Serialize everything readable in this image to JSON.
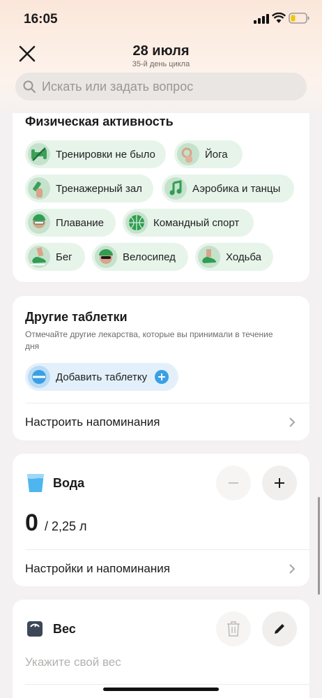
{
  "status_bar": {
    "time": "16:05"
  },
  "header": {
    "title": "28 июля",
    "subtitle": "35-й день цикла"
  },
  "search": {
    "placeholder": "Искать или задать вопрос"
  },
  "activity": {
    "title": "Физическая активность",
    "chips": [
      {
        "label": "Тренировки не было",
        "icon": "no-dumbbell-icon"
      },
      {
        "label": "Йога",
        "icon": "yoga-hand-icon"
      },
      {
        "label": "Тренажерный зал",
        "icon": "dumbbell-icon"
      },
      {
        "label": "Аэробика и танцы",
        "icon": "music-note-icon"
      },
      {
        "label": "Плавание",
        "icon": "swimmer-icon"
      },
      {
        "label": "Командный спорт",
        "icon": "ball-icon"
      },
      {
        "label": "Бег",
        "icon": "running-shoe-icon"
      },
      {
        "label": "Велосипед",
        "icon": "cyclist-icon"
      },
      {
        "label": "Ходьба",
        "icon": "walking-shoe-icon"
      }
    ]
  },
  "pills": {
    "title": "Другие таблетки",
    "description": "Отмечайте другие лекарства, которые вы принимали в течение дня",
    "add_label": "Добавить таблетку",
    "reminders_label": "Настроить напоминания"
  },
  "water": {
    "title": "Вода",
    "current": "0",
    "target": "/ 2,25 л",
    "settings_label": "Настройки и напоминания"
  },
  "weight": {
    "title": "Вес",
    "placeholder": "Укажите свой вес"
  },
  "colors": {
    "chip_bg": "#e7f4ea",
    "accent_green": "#2f9e52",
    "accent_blue": "#3aa0e6"
  }
}
